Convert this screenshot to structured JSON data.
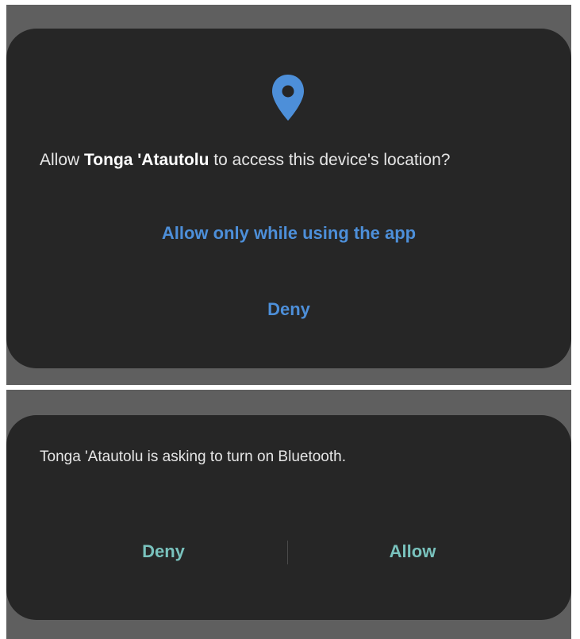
{
  "location_dialog": {
    "icon": "location-pin-icon",
    "prompt_prefix": "Allow ",
    "app_name": "Tonga 'Atautolu",
    "prompt_suffix": " to access this device's location?",
    "allow_while_using_label": "Allow only while using the app",
    "deny_label": "Deny"
  },
  "bluetooth_dialog": {
    "message": "Tonga 'Atautolu is asking to turn on Bluetooth.",
    "deny_label": "Deny",
    "allow_label": "Allow"
  },
  "colors": {
    "dialog_background": "#262626",
    "backdrop": "#5f5f5f",
    "location_action": "#4d8fd9",
    "bluetooth_action": "#79c2bd"
  }
}
